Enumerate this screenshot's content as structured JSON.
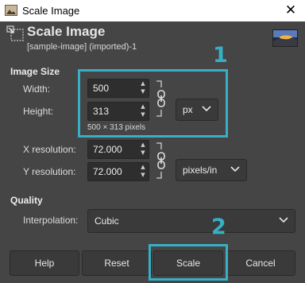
{
  "window": {
    "title": "Scale Image",
    "close_glyph": "✕"
  },
  "header": {
    "title": "Scale Image",
    "subtitle": "[sample-image] (imported)-1"
  },
  "image_size": {
    "section_label": "Image Size",
    "width_label": "Width:",
    "width_value": "500",
    "height_label": "Height:",
    "height_value": "313",
    "unit": "px",
    "pixel_info": "500 × 313 pixels"
  },
  "resolution": {
    "x_label": "X resolution:",
    "x_value": "72.000",
    "y_label": "Y resolution:",
    "y_value": "72.000",
    "unit": "pixels/in"
  },
  "quality": {
    "section_label": "Quality",
    "interpolation_label": "Interpolation:",
    "interpolation_value": "Cubic"
  },
  "buttons": {
    "help": "Help",
    "reset": "Reset",
    "scale": "Scale",
    "cancel": "Cancel"
  },
  "annotations": {
    "one": "1",
    "two": "2"
  },
  "colors": {
    "highlight": "#35b0c6",
    "background": "#454545"
  }
}
